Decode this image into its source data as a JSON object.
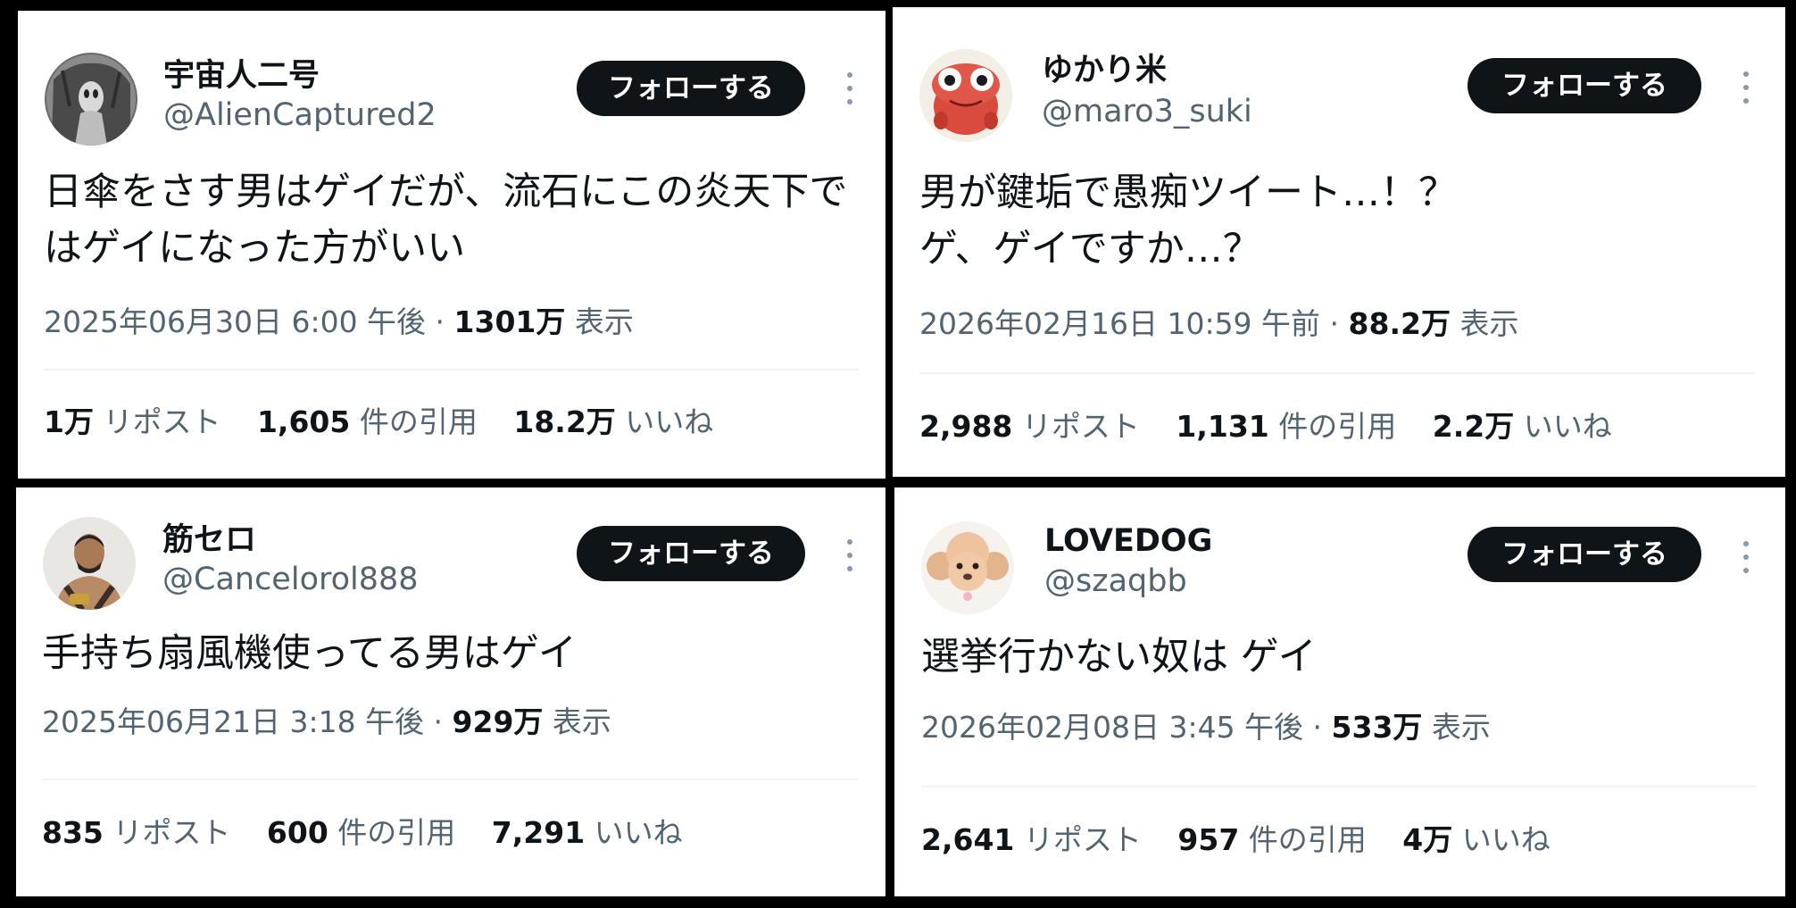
{
  "colors": {
    "background": "#000000",
    "card": "#ffffff",
    "button": "#0f1419",
    "secondary_text": "#536471"
  },
  "tweets": [
    {
      "name": "宇宙人二号",
      "handle": "@AlienCaptured2",
      "avatar_icon": "alien-photo-avatar-icon",
      "follow_label": "フォローする",
      "text_lines": [
        "日傘をさす男はゲイだが、流石にこの炎天下で",
        "はゲイになった方がいい"
      ],
      "date": "2025年06月30日 6:00 午後",
      "sep": " · ",
      "views": "1301万",
      "views_label": " 表示",
      "reposts": "1万",
      "reposts_label": " リポスト",
      "quotes": "1,605",
      "quotes_label": " 件の引用",
      "likes": "18.2万",
      "likes_label": " いいね"
    },
    {
      "name": "ゆかり米",
      "handle": "@maro3_suki",
      "avatar_icon": "red-frog-character-avatar-icon",
      "follow_label": "フォローする",
      "text_lines": [
        "男が鍵垢で愚痴ツイート…！？",
        "ゲ、ゲイですか…？"
      ],
      "date": "2026年02月16日 10:59 午前",
      "sep": " · ",
      "views": "88.2万",
      "views_label": " 表示",
      "reposts": "2,988",
      "reposts_label": " リポスト",
      "quotes": "1,131",
      "quotes_label": " 件の引用",
      "likes": "2.2万",
      "likes_label": " いいね"
    },
    {
      "name": "筋セロ",
      "handle": "@Cancelorol888",
      "avatar_icon": "fighter-photo-avatar-icon",
      "follow_label": "フォローする",
      "text_lines": [
        "手持ち扇風機使ってる男はゲイ"
      ],
      "date": "2025年06月21日 3:18 午後",
      "sep": " · ",
      "views": "929万",
      "views_label": " 表示",
      "reposts": "835",
      "reposts_label": " リポスト",
      "quotes": "600",
      "quotes_label": " 件の引用",
      "likes": "7,291",
      "likes_label": " いいね"
    },
    {
      "name": "LOVEDOG",
      "handle": "@szaqbb",
      "avatar_icon": "poodle-photo-avatar-icon",
      "follow_label": "フォローする",
      "text_lines": [
        "選挙行かない奴は ゲイ"
      ],
      "date": "2026年02月08日 3:45 午後",
      "sep": " · ",
      "views": "533万",
      "views_label": " 表示",
      "reposts": "2,641",
      "reposts_label": " リポスト",
      "quotes": "957",
      "quotes_label": " 件の引用",
      "likes": "4万",
      "likes_label": " いいね"
    }
  ]
}
